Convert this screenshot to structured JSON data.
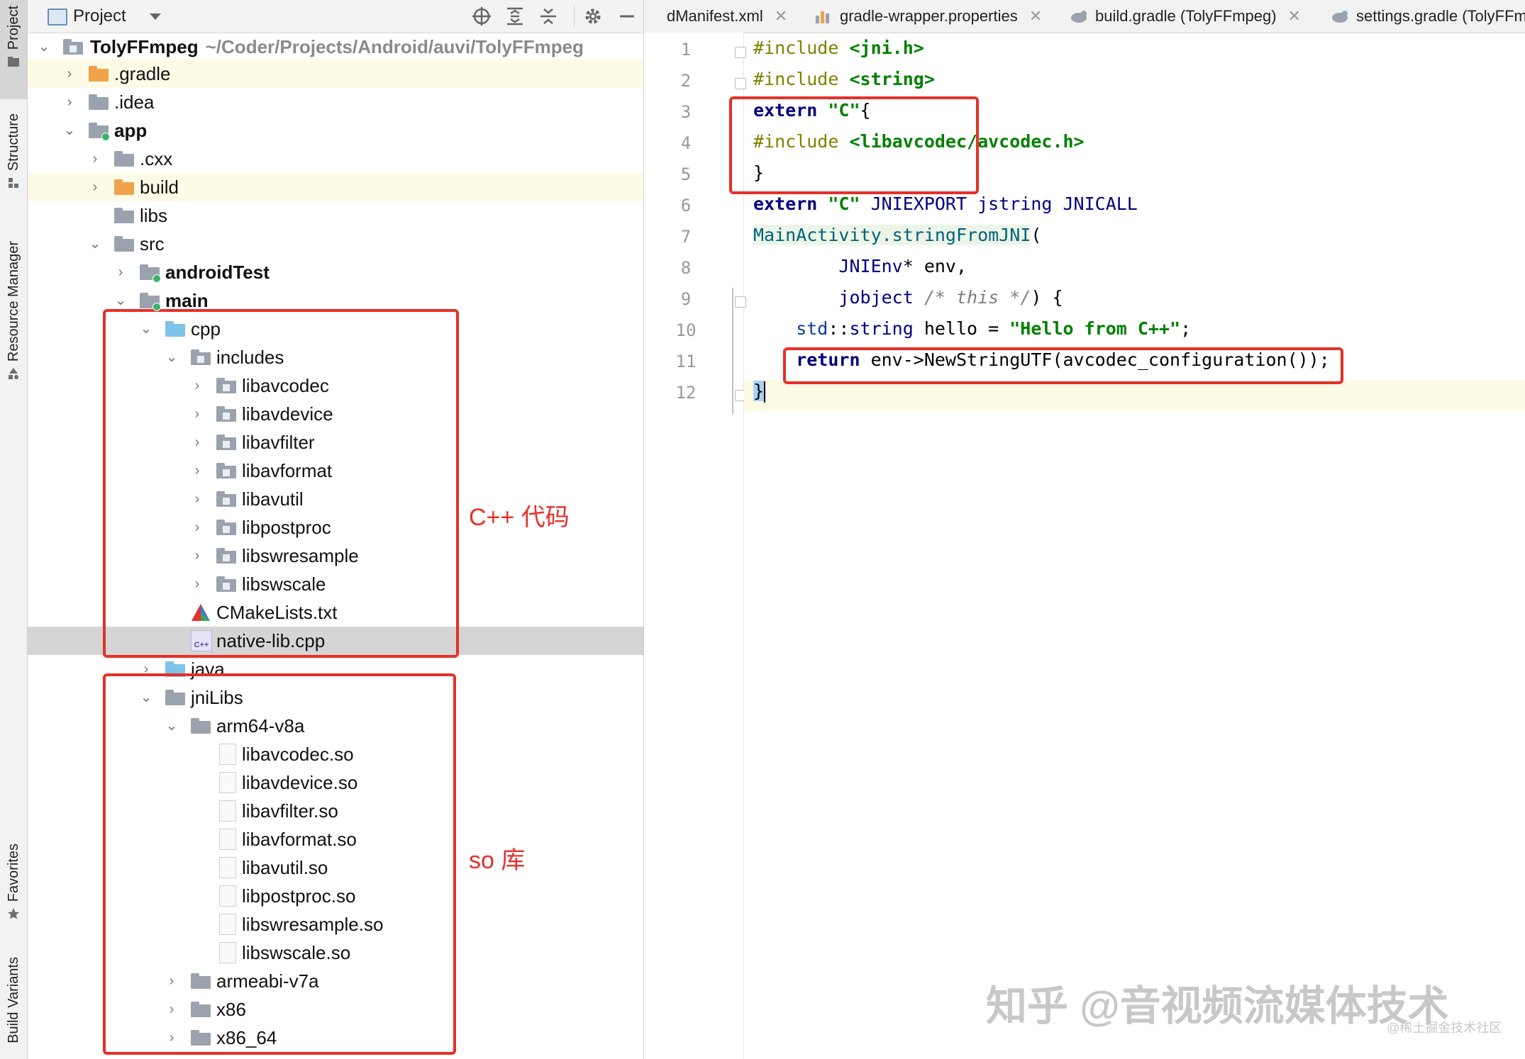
{
  "side_tabs": [
    "Project",
    "Structure",
    "Resource Manager",
    "Favorites",
    "Build Variants"
  ],
  "project_panel": {
    "title": "Project",
    "tree": [
      {
        "label": "TolyFFmpeg",
        "path": "~/Coder/Projects/Android/auvi/TolyFFmpeg"
      },
      {
        "label": ".gradle"
      },
      {
        "label": ".idea"
      },
      {
        "label": "app"
      },
      {
        "label": ".cxx"
      },
      {
        "label": "build"
      },
      {
        "label": "libs"
      },
      {
        "label": "src"
      },
      {
        "label": "androidTest"
      },
      {
        "label": "main"
      },
      {
        "label": "cpp"
      },
      {
        "label": "includes"
      },
      {
        "label": "libavcodec"
      },
      {
        "label": "libavdevice"
      },
      {
        "label": "libavfilter"
      },
      {
        "label": "libavformat"
      },
      {
        "label": "libavutil"
      },
      {
        "label": "libpostproc"
      },
      {
        "label": "libswresample"
      },
      {
        "label": "libswscale"
      },
      {
        "label": "CMakeLists.txt"
      },
      {
        "label": "native-lib.cpp"
      },
      {
        "label": "java"
      },
      {
        "label": "jniLibs"
      },
      {
        "label": "arm64-v8a"
      },
      {
        "label": "libavcodec.so"
      },
      {
        "label": "libavdevice.so"
      },
      {
        "label": "libavfilter.so"
      },
      {
        "label": "libavformat.so"
      },
      {
        "label": "libavutil.so"
      },
      {
        "label": "libpostproc.so"
      },
      {
        "label": "libswresample.so"
      },
      {
        "label": "libswscale.so"
      },
      {
        "label": "armeabi-v7a"
      },
      {
        "label": "x86"
      },
      {
        "label": "x86_64"
      }
    ]
  },
  "annotations": {
    "cpp_note": "C++ 代码",
    "so_note": "so 库"
  },
  "editor_tabs": [
    {
      "label": "dManifest.xml"
    },
    {
      "label": "gradle-wrapper.properties"
    },
    {
      "label": "build.gradle (TolyFFmpeg)"
    },
    {
      "label": "settings.gradle (TolyFFm"
    }
  ],
  "code": {
    "line_numbers": [
      "1",
      "2",
      "3",
      "4",
      "5",
      "6",
      "7",
      "8",
      "9",
      "10",
      "11",
      "12"
    ],
    "l1_a": "#include ",
    "l1_b": "<jni.h>",
    "l2_a": "#include ",
    "l2_b": "<string>",
    "l3_a": "extern ",
    "l3_b": "\"C\"",
    "l3_c": "{",
    "l4_a": "#include ",
    "l4_b": "<libavcodec/avcodec.h>",
    "l5": "}",
    "l6_a": "extern ",
    "l6_b": "\"C\"",
    "l6_c": " JNIEXPORT jstring JNICALL",
    "l7_a": "MainActivity.stringFromJNI",
    "l7_b": "(",
    "l8_a": "        JNIEnv",
    "l8_b": "* env,",
    "l9_a": "        jobject ",
    "l9_b": "/* this */",
    "l9_c": ") {",
    "l10_a": "    std",
    "l10_b": "::",
    "l10_c": "string",
    "l10_d": " hello = ",
    "l10_e": "\"Hello from C++\"",
    "l10_f": ";",
    "l11_a": "    return",
    "l11_b": " env->NewStringUTF(avcodec_configuration());",
    "l12": "}"
  },
  "watermark": {
    "main": "知乎 @音视频流媒体技术",
    "small": "@稀土掘金技术社区"
  }
}
